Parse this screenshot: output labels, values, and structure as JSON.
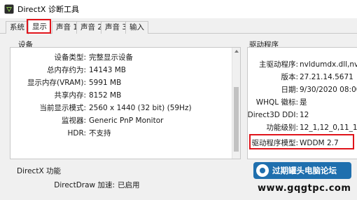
{
  "window": {
    "title": "DirectX 诊断工具"
  },
  "tabs": [
    {
      "label": "系统",
      "active": false
    },
    {
      "label": "显示",
      "active": true
    },
    {
      "label": "声音 1",
      "active": false
    },
    {
      "label": "声音 2",
      "active": false
    },
    {
      "label": "声音 3",
      "active": false
    },
    {
      "label": "输入",
      "active": false
    }
  ],
  "device": {
    "group_label": "设备",
    "rows": [
      {
        "key": "设备类型:",
        "value": "完整显示设备"
      },
      {
        "key": "总内存约为:",
        "value": "14143 MB"
      },
      {
        "key": "显示内存(VRAM):",
        "value": "5991 MB"
      },
      {
        "key": "共享内存:",
        "value": "8152 MB"
      },
      {
        "key": "当前显示模式:",
        "value": "2560 x 1440 (32 bit) (59Hz)"
      },
      {
        "key": "监视器:",
        "value": "Generic PnP Monitor"
      },
      {
        "key": "HDR:",
        "value": "不支持"
      }
    ]
  },
  "drivers": {
    "group_label": "驱动程序",
    "rows": [
      {
        "key": "主驱动程序:",
        "value": "nvldumdx.dll,nvldum"
      },
      {
        "key": "版本:",
        "value": "27.21.14.5671"
      },
      {
        "key": "日期:",
        "value": "9/30/2020 08:00:00"
      },
      {
        "key": "WHQL 徽标:",
        "value": "是"
      },
      {
        "key": "Direct3D DDI:",
        "value": "12"
      },
      {
        "key": "功能级别:",
        "value": "12_1,12_0,11_1,11_0"
      },
      {
        "key": "驱动程序模型:",
        "value": "WDDM 2.7"
      }
    ]
  },
  "directx": {
    "group_label": "DirectX 功能",
    "rows": [
      {
        "key": "DirectDraw 加速:",
        "value": "已启用"
      }
    ]
  },
  "watermark": {
    "badge_text": "过期罐头电脑论坛",
    "url": "www.gqgtpc.com"
  },
  "colors": {
    "highlight": "#e0141b",
    "badge": "#1f6fae"
  }
}
